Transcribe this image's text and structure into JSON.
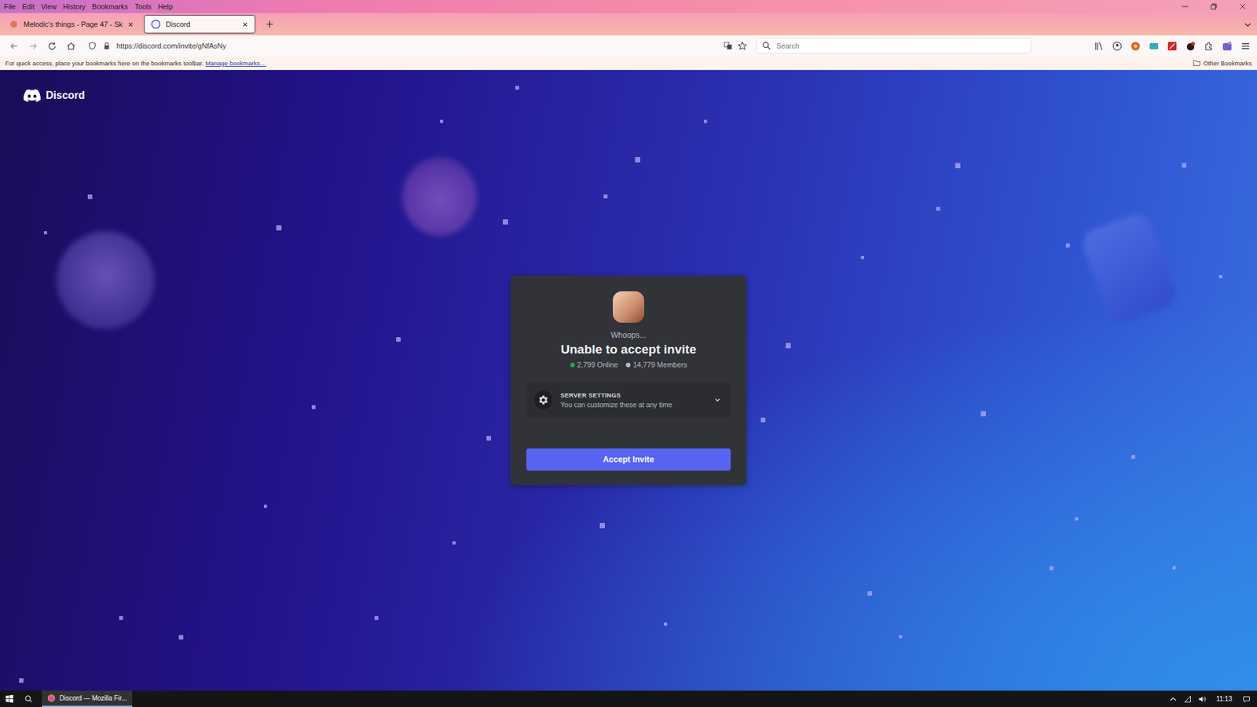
{
  "menu": [
    "File",
    "Edit",
    "View",
    "History",
    "Bookmarks",
    "Tools",
    "Help"
  ],
  "tabs": [
    {
      "label": "Melodic's things - Page 47 - Sk",
      "selected": false
    },
    {
      "label": "Discord",
      "selected": true
    }
  ],
  "address_bar": {
    "url": "https://discord.com/invite/gNfAsNy"
  },
  "search": {
    "placeholder": "Search"
  },
  "bookmarks_bar": {
    "hint": "For quick access, place your bookmarks here on the bookmarks toolbar.",
    "link": "Manage bookmarks…",
    "other": "Other Bookmarks"
  },
  "page": {
    "brand": "Discord",
    "invite": {
      "subtitle": "Whoops...",
      "title": "Unable to accept invite",
      "stats": [
        {
          "label": "2,799 Online",
          "color": "#23a55a"
        },
        {
          "label": "14,779 Members",
          "color": "#b5bac1"
        }
      ],
      "settings": {
        "title": "SERVER SETTINGS",
        "description": "You can customize these at any time",
        "expanded": false
      },
      "button": "Accept Invite"
    }
  },
  "taskbar": {
    "tasks": [
      {
        "label": "Discord — Mozilla Fir...",
        "selected": true
      }
    ],
    "clock": "11:13"
  }
}
